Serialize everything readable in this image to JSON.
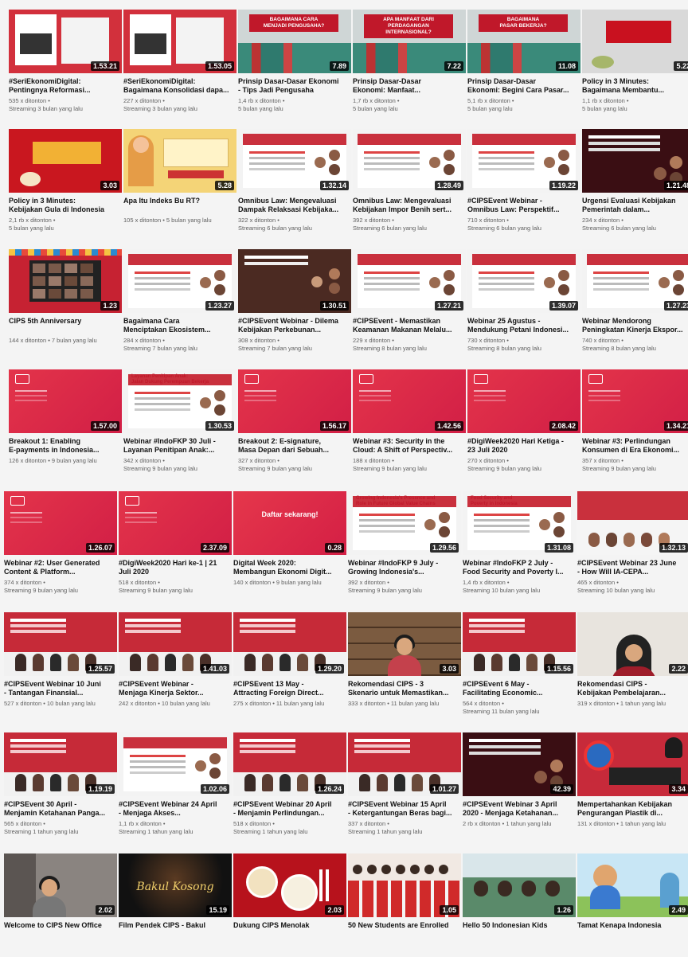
{
  "colors": {
    "brand_red": "#d32f3a",
    "dark_red": "#b31c2b",
    "meta_gray": "#606060"
  },
  "videos": [
    {
      "title": "#SeriEkonomiDigital:\nPentingnya Reformasi...",
      "meta": "535 x ditonton •\nStreaming 3 bulan yang lalu",
      "duration": "1.53.21",
      "thumb": "slides-red"
    },
    {
      "title": "#SeriEkonomiDigital:\nBagaimana Konsolidasi dapa...",
      "meta": "227 x ditonton •\nStreaming 3 bulan yang lalu",
      "duration": "1.53.05",
      "thumb": "slides-red"
    },
    {
      "title": "Prinsip Dasar-Dasar Ekonomi\n- Tips Jadi Pengusaha",
      "meta": "1,4 rb x ditonton •\n5 bulan yang lalu",
      "duration": "7.89",
      "thumb": "port",
      "caption": "BAGAIMANA CARA\nMENJADI PENGUSAHA?"
    },
    {
      "title": "Prinsip Dasar-Dasar\nEkonomi: Manfaat...",
      "meta": "1,7 rb x ditonton •\n5 bulan yang lalu",
      "duration": "7.22",
      "thumb": "port",
      "caption": "APA MANFAAT DARI\nPERDAGANGAN\nINTERNASIONAL?"
    },
    {
      "title": "Prinsip Dasar-Dasar\nEkonomi: Begini Cara Pasar...",
      "meta": "5,1 rb x ditonton •\n5 bulan yang lalu",
      "duration": "11.08",
      "thumb": "port",
      "caption": "BAGAIMANA\nPASAR BEKERJA?"
    },
    {
      "title": "Policy in 3 Minutes:\nBagaimana Membantu...",
      "meta": "1,1 rb x ditonton •\n5 bulan yang lalu",
      "duration": "5.22",
      "thumb": "gray-red"
    },
    {
      "title": "Policy in 3 Minutes:\nKebijakan Gula di Indonesia",
      "meta": "2,1 rb x ditonton •\n5 bulan yang lalu",
      "duration": "3.03",
      "thumb": "red-orange"
    },
    {
      "title": "Apa Itu Indeks Bu RT?",
      "meta": "105 x ditonton • 5 bulan yang lalu",
      "duration": "5.28",
      "thumb": "cartoon"
    },
    {
      "title": "Omnibus Law: Mengevaluasi\nDampak Relaksasi Kebijaka...",
      "meta": "322 x ditonton •\nStreaming 6 bulan yang lalu",
      "duration": "1.32.14",
      "thumb": "slide-white"
    },
    {
      "title": "Omnibus Law: Mengevaluasi\nKebijakan Impor Benih sert...",
      "meta": "392 x ditonton •\nStreaming 6 bulan yang lalu",
      "duration": "1.28.49",
      "thumb": "slide-white"
    },
    {
      "title": "#CIPSEvent Webinar -\nOmnibus Law: Perspektif...",
      "meta": "710 x ditonton •\nStreaming 6 bulan yang lalu",
      "duration": "1.19.22",
      "thumb": "slide-white"
    },
    {
      "title": "Urgensi Evaluasi Kebijakan\nPemerintah dalam...",
      "meta": "234 x ditonton •\nStreaming 6 bulan yang lalu",
      "duration": "1.21.48",
      "thumb": "dark-red"
    },
    {
      "title": "CIPS 5th Anniversary",
      "meta": "144 x ditonton • 7 bulan yang lalu",
      "duration": "1.23",
      "thumb": "zoom"
    },
    {
      "title": "Bagaimana Cara\nMenciptakan Ekosistem...",
      "meta": "284 x ditonton •\nStreaming 7 bulan yang lalu",
      "duration": "1.23.27",
      "thumb": "slide-white"
    },
    {
      "title": "#CIPSEvent Webinar - Dilema\nKebijakan Perkebunan...",
      "meta": "308 x ditonton •\nStreaming 7 bulan yang lalu",
      "duration": "1.30.51",
      "thumb": "dark-brown"
    },
    {
      "title": "#CIPSEvent - Memastikan\nKeamanan Makanan Melalu...",
      "meta": "229 x ditonton •\nStreaming 8 bulan yang lalu",
      "duration": "1.27.21",
      "thumb": "slide-white"
    },
    {
      "title": "Webinar 25 Agustus -\nMendukung Petani Indonesi...",
      "meta": "730 x ditonton •\nStreaming 8 bulan yang lalu",
      "duration": "1.39.07",
      "thumb": "slide-white"
    },
    {
      "title": "Webinar Mendorong\nPeningkatan Kinerja Ekspor...",
      "meta": "740 x ditonton •\nStreaming 8 bulan yang lalu",
      "duration": "1.27.23",
      "thumb": "slide-white"
    },
    {
      "title": "Breakout 1: Enabling\nE-payments in Indonesia...",
      "meta": "126 x ditonton • 9 bulan yang lalu",
      "duration": "1.57.00",
      "thumb": "pink"
    },
    {
      "title": "Webinar #IndoFKP 30 Juli -\nLayanan Penitipan Anak:...",
      "meta": "342 x ditonton •\nStreaming 9 bulan yang lalu",
      "duration": "1.30.53",
      "thumb": "slide-white",
      "caption": "Layanan Penitipan Anak:\nJalan Dukung Perempuan Bekerja"
    },
    {
      "title": "Breakout 2: E-signature,\nMasa Depan dari Sebuah...",
      "meta": "327 x ditonton •\nStreaming 9 bulan yang lalu",
      "duration": "1.56.17",
      "thumb": "pink"
    },
    {
      "title": "Webinar #3: Security in the\nCloud: A Shift of Perspectiv...",
      "meta": "188 x ditonton •\nStreaming 9 bulan yang lalu",
      "duration": "1.42.56",
      "thumb": "pink"
    },
    {
      "title": "#DigiWeek2020 Hari Ketiga -\n23 Juli 2020",
      "meta": "270 x ditonton •\nStreaming 9 bulan yang lalu",
      "duration": "2.08.42",
      "thumb": "pink"
    },
    {
      "title": "Webinar #3: Perlindungan\nKonsumen di Era Ekonomi...",
      "meta": "357 x ditonton •\nStreaming 9 bulan yang lalu",
      "duration": "1.34.21",
      "thumb": "pink"
    },
    {
      "title": "Webinar #2: User Generated\nContent & Platform...",
      "meta": "374 x ditonton •\nStreaming 9 bulan yang lalu",
      "duration": "1.26.07",
      "thumb": "pink"
    },
    {
      "title": "#DigiWeek2020 Hari ke-1 | 21\nJuli 2020",
      "meta": "518 x ditonton •\nStreaming 9 bulan yang lalu",
      "duration": "2.37.09",
      "thumb": "pink"
    },
    {
      "title": "Digital Week 2020:\nMembangun Ekonomi Digit...",
      "meta": "140 x ditonton • 9 bulan yang lalu",
      "duration": "0.28",
      "thumb": "pink-cta",
      "caption": "Daftar sekarang!"
    },
    {
      "title": "Webinar #IndoFKP 9 July -\nGrowing Indonesia's...",
      "meta": "392 x ditonton •\nStreaming 9 bulan yang lalu",
      "duration": "1.29.56",
      "thumb": "slide-white",
      "caption": "Growing Indonesia's Presence and\nRole in Future Global Value Chains"
    },
    {
      "title": "Webinar #IndoFKP 2 July -\nFood Security and Poverty I...",
      "meta": "1,4 rb x ditonton •\nStreaming 10 bulan yang lalu",
      "duration": "1.31.08",
      "thumb": "slide-white",
      "caption": "Food Security and\nPoverty in Indonesia"
    },
    {
      "title": "#CIPSEvent Webinar 23 June\n- How Will IA-CEPA...",
      "meta": "465 x ditonton •\nStreaming 10 bulan yang lalu",
      "duration": "1.32.13",
      "thumb": "slide-red-top"
    },
    {
      "title": "#CIPSEvent Webinar 10 Juni\n- Tantangan Finansial...",
      "meta": "527 x ditonton • 10 bulan yang lalu",
      "duration": "1.25.57",
      "thumb": "slide-people"
    },
    {
      "title": "#CIPSEvent Webinar -\nMenjaga Kinerja Sektor...",
      "meta": "242 x ditonton • 10 bulan yang lalu",
      "duration": "1.41.03",
      "thumb": "slide-people"
    },
    {
      "title": "#CIPSEvent 13 May -\nAttracting Foreign Direct...",
      "meta": "275 x ditonton • 11 bulan yang lalu",
      "duration": "1.29.20",
      "thumb": "slide-people"
    },
    {
      "title": "Rekomendasi CIPS - 3\nSkenario untuk Memastikan...",
      "meta": "333 x ditonton • 11 bulan yang lalu",
      "duration": "3.03",
      "thumb": "bookshelf"
    },
    {
      "title": "#CIPSEvent 6 May -\nFacilitating Economic...",
      "meta": "564 x ditonton •\nStreaming 11 bulan yang lalu",
      "duration": "1.15.56",
      "thumb": "slide-people"
    },
    {
      "title": "Rekomendasi CIPS -\nKebijakan Pembelajaran...",
      "meta": "319 x ditonton • 1 tahun yang lalu",
      "duration": "2.22",
      "thumb": "hijab"
    },
    {
      "title": "#CIPSEvent 30 April -\nMenjamin Ketahanan Panga...",
      "meta": "565 x ditonton •\nStreaming 1 tahun yang lalu",
      "duration": "1.19.19",
      "thumb": "slide-people"
    },
    {
      "title": "#CIPSEvent Webinar 24 April\n- Menjaga Akses...",
      "meta": "1,1 rb x ditonton •\nStreaming 1 tahun yang lalu",
      "duration": "1.02.06",
      "thumb": "slide-white"
    },
    {
      "title": "#CIPSEvent Webinar 20 April\n- Menjamin Perlindungan...",
      "meta": "518 x ditonton •\nStreaming 1 tahun yang lalu",
      "duration": "1.26.24",
      "thumb": "slide-people"
    },
    {
      "title": "#CIPSEvent Webinar 15 April\n- Ketergantungan Beras bagi...",
      "meta": "337 x ditonton •\nStreaming 1 tahun yang lalu",
      "duration": "1.01.27",
      "thumb": "slide-people"
    },
    {
      "title": "#CIPSEvent Webinar 3 April\n2020 - Menjaga Ketahanan...",
      "meta": "2 rb x ditonton • 1 tahun yang lalu",
      "duration": "42.39",
      "thumb": "dark-red"
    },
    {
      "title": "Mempertahankan Kebijakan\nPengurangan Plastik di...",
      "meta": "131 x ditonton • 1 tahun yang lalu",
      "duration": "3.34",
      "thumb": "plastic"
    },
    {
      "title": "Welcome to CIPS New Office",
      "meta": "",
      "duration": "2.02",
      "thumb": "office"
    },
    {
      "title": "Film Pendek CIPS - Bakul",
      "meta": "",
      "duration": "15.19",
      "thumb": "dark-film",
      "caption": "Bakul Kosong"
    },
    {
      "title": "Dukung CIPS Menolak",
      "meta": "",
      "duration": "2.03",
      "thumb": "red-food"
    },
    {
      "title": "50 New Students are Enrolled",
      "meta": "",
      "duration": "1.05",
      "thumb": "students"
    },
    {
      "title": "Hello 50 Indonesian Kids",
      "meta": "",
      "duration": "1.26",
      "thumb": "kids"
    },
    {
      "title": "Tamat Kenapa Indonesia",
      "meta": "",
      "duration": "2.49",
      "thumb": "cartoon-village"
    }
  ]
}
